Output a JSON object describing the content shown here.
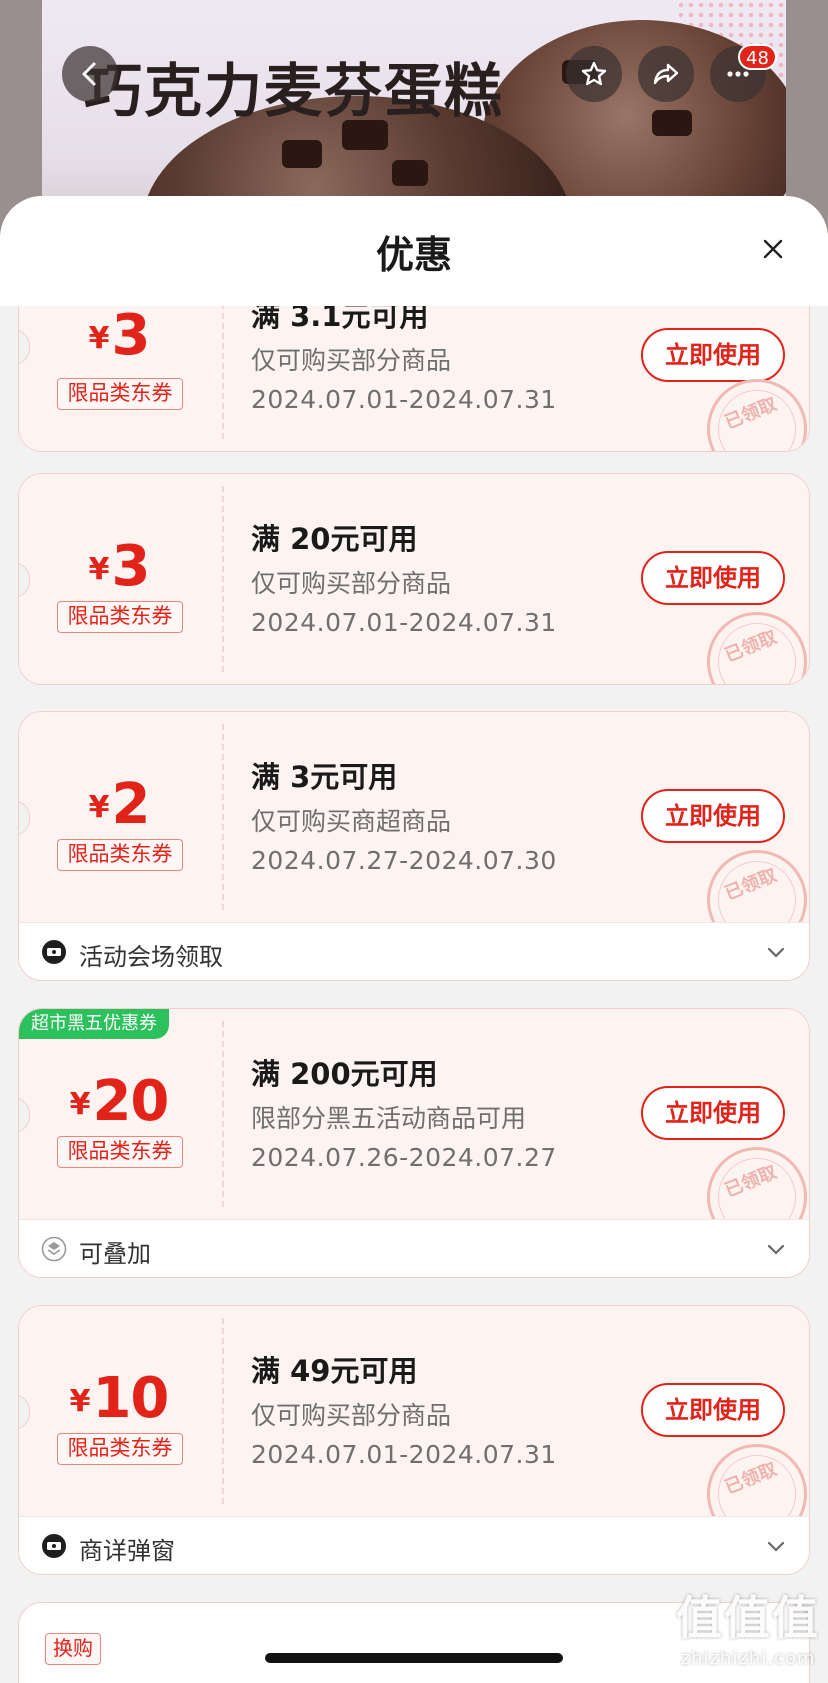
{
  "product": {
    "title": "巧克力麦芬蛋糕",
    "more_badge": "48"
  },
  "sheet": {
    "title": "优惠"
  },
  "coupons": [
    {
      "currency": "¥",
      "amount": "3",
      "tag": "限品类东券",
      "condition": "满 3.1元可用",
      "scope": "仅可购买部分商品",
      "dates": "2024.07.01-2024.07.31",
      "button": "立即使用",
      "stamp": "已领取"
    },
    {
      "currency": "¥",
      "amount": "3",
      "tag": "限品类东券",
      "condition": "满 20元可用",
      "scope": "仅可购买部分商品",
      "dates": "2024.07.01-2024.07.31",
      "button": "立即使用",
      "stamp": "已领取"
    },
    {
      "currency": "¥",
      "amount": "2",
      "tag": "限品类东券",
      "condition": "满 3元可用",
      "scope": "仅可购买商超商品",
      "dates": "2024.07.27-2024.07.30",
      "button": "立即使用",
      "stamp": "已领取",
      "footer": "活动会场领取"
    },
    {
      "ribbon": "超市黑五优惠券",
      "currency": "¥",
      "amount": "20",
      "tag": "限品类东券",
      "condition": "满 200元可用",
      "scope": "限部分黑五活动商品可用",
      "dates": "2024.07.26-2024.07.27",
      "button": "立即使用",
      "stamp": "已领取",
      "footer": "可叠加"
    },
    {
      "currency": "¥",
      "amount": "10",
      "tag": "限品类东券",
      "condition": "满 49元可用",
      "scope": "仅可购买部分商品",
      "dates": "2024.07.01-2024.07.31",
      "button": "立即使用",
      "stamp": "已领取",
      "footer": "商详弹窗"
    },
    {
      "tag": "换购"
    }
  ],
  "watermark": {
    "big": "值值值",
    "small": "zhizhizhi.com"
  },
  "colors": {
    "accent": "#e2231a",
    "ribbon": "#2bc15c",
    "coupon_bg": "#fdf4f2"
  }
}
